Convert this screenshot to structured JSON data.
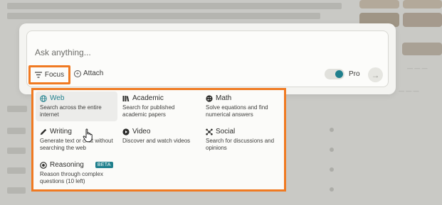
{
  "input": {
    "placeholder": "Ask anything..."
  },
  "toolbar": {
    "focus_label": "Focus",
    "attach_label": "Attach",
    "pro_label": "Pro",
    "pro_enabled": true
  },
  "focus_menu": {
    "options": [
      {
        "title": "Web",
        "description": "Search across the entire internet",
        "icon": "globe-icon",
        "active": true
      },
      {
        "title": "Academic",
        "description": "Search for published academic papers",
        "icon": "books-icon",
        "active": false
      },
      {
        "title": "Math",
        "description": "Solve equations and find numerical answers",
        "icon": "math-icon",
        "active": false
      },
      {
        "title": "Writing",
        "description": "Generate text or chat without searching the web",
        "icon": "pencil-icon",
        "active": false
      },
      {
        "title": "Video",
        "description": "Discover and watch videos",
        "icon": "play-icon",
        "active": false
      },
      {
        "title": "Social",
        "description": "Search for discussions and opinions",
        "icon": "social-icon",
        "active": false
      },
      {
        "title": "Reasoning",
        "badge": "BETA",
        "description": "Reason through complex questions (10 left)",
        "icon": "reasoning-icon",
        "active": false
      }
    ]
  },
  "colors": {
    "accent": "#20808d",
    "highlight_box": "#f07a22"
  }
}
